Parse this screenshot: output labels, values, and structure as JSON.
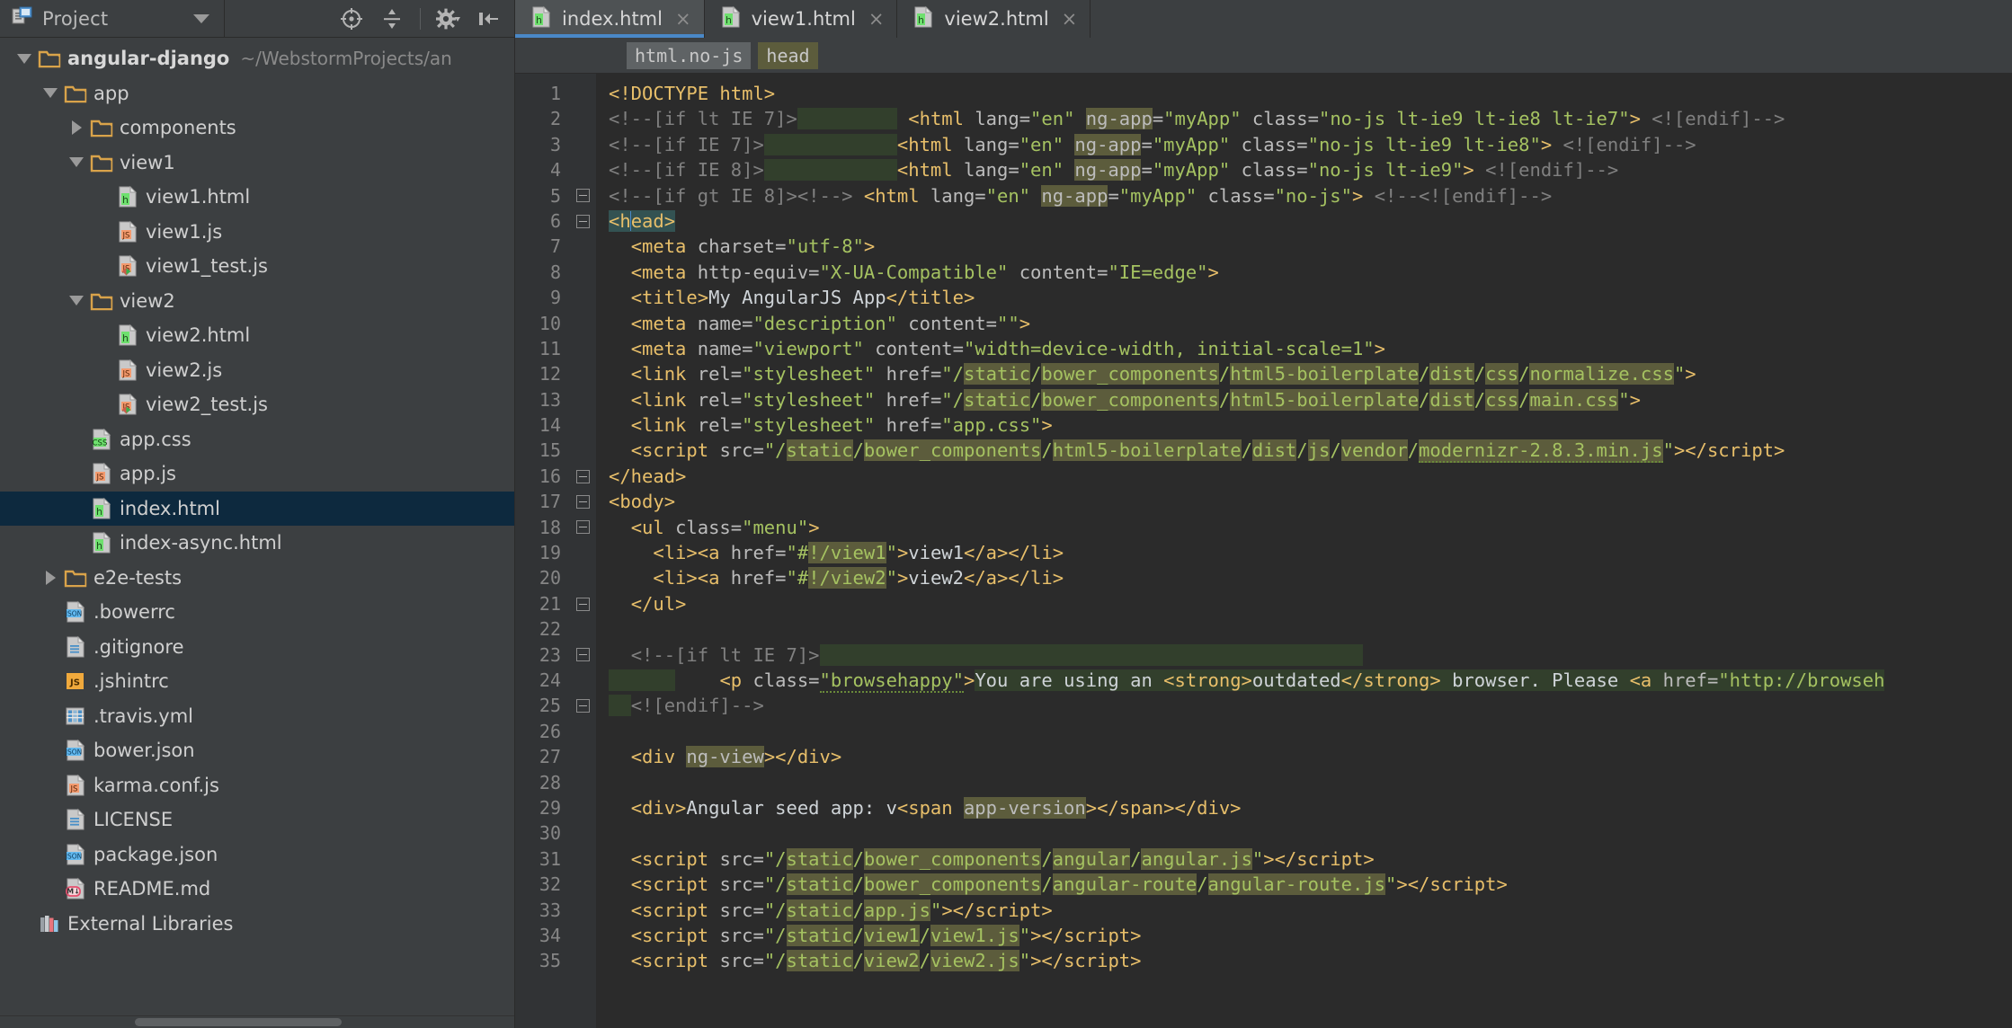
{
  "window": {
    "project_panel_title": "Project",
    "theme_accent": "#4a88c7",
    "editor_bg": "#2b2b2b",
    "panel_bg": "#3c3f41",
    "selection_bg": "#0d293e"
  },
  "toolbar": {
    "icons": [
      {
        "name": "locate-icon",
        "label": "Select Opened File"
      },
      {
        "name": "collapse-all-icon",
        "label": "Collapse All"
      },
      {
        "name": "settings-gear-icon",
        "label": "Settings"
      },
      {
        "name": "hide-panel-icon",
        "label": "Hide"
      }
    ]
  },
  "tabs": [
    {
      "label": "index.html",
      "icon": "html-file-icon",
      "active": true,
      "close": "×"
    },
    {
      "label": "view1.html",
      "icon": "html-file-icon",
      "active": false,
      "close": "×"
    },
    {
      "label": "view2.html",
      "icon": "html-file-icon",
      "active": false,
      "close": "×"
    }
  ],
  "breadcrumb": [
    {
      "label": "html.no-js",
      "style": "gray"
    },
    {
      "label": "head",
      "style": "olive"
    }
  ],
  "tree": [
    {
      "indent": 0,
      "toggle": "open",
      "icon": "folder-icon",
      "label": "angular-django",
      "bold": true,
      "path": "~/WebstormProjects/an",
      "selected": false
    },
    {
      "indent": 1,
      "toggle": "open",
      "icon": "folder-icon",
      "label": "app",
      "bold": false,
      "path": "",
      "selected": false
    },
    {
      "indent": 2,
      "toggle": "closed",
      "icon": "folder-icon",
      "label": "components",
      "bold": false,
      "path": "",
      "selected": false
    },
    {
      "indent": 2,
      "toggle": "open",
      "icon": "folder-icon",
      "label": "view1",
      "bold": false,
      "path": "",
      "selected": false
    },
    {
      "indent": 3,
      "toggle": "none",
      "icon": "html-file-icon",
      "label": "view1.html",
      "bold": false,
      "path": "",
      "selected": false
    },
    {
      "indent": 3,
      "toggle": "none",
      "icon": "js-file-icon",
      "label": "view1.js",
      "bold": false,
      "path": "",
      "selected": false
    },
    {
      "indent": 3,
      "toggle": "none",
      "icon": "js-test-file-icon",
      "label": "view1_test.js",
      "bold": false,
      "path": "",
      "selected": false
    },
    {
      "indent": 2,
      "toggle": "open",
      "icon": "folder-icon",
      "label": "view2",
      "bold": false,
      "path": "",
      "selected": false
    },
    {
      "indent": 3,
      "toggle": "none",
      "icon": "html-file-icon",
      "label": "view2.html",
      "bold": false,
      "path": "",
      "selected": false
    },
    {
      "indent": 3,
      "toggle": "none",
      "icon": "js-file-icon",
      "label": "view2.js",
      "bold": false,
      "path": "",
      "selected": false
    },
    {
      "indent": 3,
      "toggle": "none",
      "icon": "js-test-file-icon",
      "label": "view2_test.js",
      "bold": false,
      "path": "",
      "selected": false
    },
    {
      "indent": 2,
      "toggle": "none",
      "icon": "css-file-icon",
      "label": "app.css",
      "bold": false,
      "path": "",
      "selected": false
    },
    {
      "indent": 2,
      "toggle": "none",
      "icon": "js-file-icon",
      "label": "app.js",
      "bold": false,
      "path": "",
      "selected": false
    },
    {
      "indent": 2,
      "toggle": "none",
      "icon": "html-file-icon",
      "label": "index.html",
      "bold": false,
      "path": "",
      "selected": true
    },
    {
      "indent": 2,
      "toggle": "none",
      "icon": "html-file-icon",
      "label": "index-async.html",
      "bold": false,
      "path": "",
      "selected": false
    },
    {
      "indent": 1,
      "toggle": "closed",
      "icon": "folder-icon",
      "label": "e2e-tests",
      "bold": false,
      "path": "",
      "selected": false
    },
    {
      "indent": 1,
      "toggle": "none",
      "icon": "json-file-icon",
      "label": ".bowerrc",
      "bold": false,
      "path": "",
      "selected": false
    },
    {
      "indent": 1,
      "toggle": "none",
      "icon": "text-file-icon",
      "label": ".gitignore",
      "bold": false,
      "path": "",
      "selected": false
    },
    {
      "indent": 1,
      "toggle": "none",
      "icon": "js-config-icon",
      "label": ".jshintrc",
      "bold": false,
      "path": "",
      "selected": false
    },
    {
      "indent": 1,
      "toggle": "none",
      "icon": "yaml-file-icon",
      "label": ".travis.yml",
      "bold": false,
      "path": "",
      "selected": false
    },
    {
      "indent": 1,
      "toggle": "none",
      "icon": "json-file-icon",
      "label": "bower.json",
      "bold": false,
      "path": "",
      "selected": false
    },
    {
      "indent": 1,
      "toggle": "none",
      "icon": "js-file-icon",
      "label": "karma.conf.js",
      "bold": false,
      "path": "",
      "selected": false
    },
    {
      "indent": 1,
      "toggle": "none",
      "icon": "text-file-icon",
      "label": "LICENSE",
      "bold": false,
      "path": "",
      "selected": false
    },
    {
      "indent": 1,
      "toggle": "none",
      "icon": "json-file-icon",
      "label": "package.json",
      "bold": false,
      "path": "",
      "selected": false
    },
    {
      "indent": 1,
      "toggle": "none",
      "icon": "markdown-file-icon",
      "label": "README.md",
      "bold": false,
      "path": "",
      "selected": false
    },
    {
      "indent": 0,
      "toggle": "none",
      "icon": "libraries-icon",
      "label": "External Libraries",
      "bold": false,
      "path": "",
      "selected": false
    }
  ],
  "editor": {
    "file": "index.html",
    "first_line": 1,
    "last_line": 35,
    "line_numbers": [
      1,
      2,
      3,
      4,
      5,
      6,
      7,
      8,
      9,
      10,
      11,
      12,
      13,
      14,
      15,
      16,
      17,
      18,
      19,
      20,
      21,
      22,
      23,
      24,
      25,
      26,
      27,
      28,
      29,
      30,
      31,
      32,
      33,
      34,
      35
    ],
    "lines": [
      {
        "n": 1,
        "fold": "none",
        "html": "<span class=\"t\">&lt;!DOCTYPE html&gt;</span>"
      },
      {
        "n": 2,
        "fold": "none",
        "html": "<span class=\"cm\">&lt;!--[if lt IE 7]&gt;</span><span class=\"hl-block\">         </span> <span class=\"t\">&lt;html</span> <span class=\"a\">lang=</span><span class=\"v\">\"en\"</span> <span class=\"hl-olive a\">ng-app</span><span class=\"a\">=</span><span class=\"v\">\"myApp\"</span> <span class=\"a\">class=</span><span class=\"v\">\"no-js lt-ie9 lt-ie8 lt-ie7\"</span><span class=\"t\">&gt;</span> <span class=\"cm\">&lt;![endif]--&gt;</span>"
      },
      {
        "n": 3,
        "fold": "none",
        "html": "<span class=\"cm\">&lt;!--[if IE 7]&gt;</span><span class=\"hl-block\">            </span><span class=\"t\">&lt;html</span> <span class=\"a\">lang=</span><span class=\"v\">\"en\"</span> <span class=\"hl-olive a\">ng-app</span><span class=\"a\">=</span><span class=\"v\">\"myApp\"</span> <span class=\"a\">class=</span><span class=\"v\">\"no-js lt-ie9 lt-ie8\"</span><span class=\"t\">&gt;</span> <span class=\"cm\">&lt;![endif]--&gt;</span>"
      },
      {
        "n": 4,
        "fold": "none",
        "html": "<span class=\"cm\">&lt;!--[if IE 8]&gt;</span><span class=\"hl-block\">            </span><span class=\"t\">&lt;html</span> <span class=\"a\">lang=</span><span class=\"v\">\"en\"</span> <span class=\"hl-olive a\">ng-app</span><span class=\"a\">=</span><span class=\"v\">\"myApp\"</span> <span class=\"a\">class=</span><span class=\"v\">\"no-js lt-ie9\"</span><span class=\"t\">&gt;</span> <span class=\"cm\">&lt;![endif]--&gt;</span>"
      },
      {
        "n": 5,
        "fold": "start",
        "html": "<span class=\"cm\">&lt;!--[if gt IE 8]&gt;&lt;!--&gt;</span> <span class=\"t\">&lt;html</span> <span class=\"a\">lang=</span><span class=\"v\">\"en\"</span> <span class=\"hl-olive a\">ng-app</span><span class=\"a\">=</span><span class=\"v\">\"myApp\"</span> <span class=\"a\">class=</span><span class=\"v\">\"no-js\"</span><span class=\"t\">&gt;</span> <span class=\"cm\">&lt;!--&lt;![endif]--&gt;</span>"
      },
      {
        "n": 6,
        "fold": "start",
        "html": "<span class=\"hl-teal t\">&lt;h</span><span class=\"caret\"></span><span class=\"hl-teal t\">ead&gt;</span>"
      },
      {
        "n": 7,
        "fold": "none",
        "html": "  <span class=\"t\">&lt;meta</span> <span class=\"a\">charset=</span><span class=\"v\">\"utf-8\"</span><span class=\"t\">&gt;</span>"
      },
      {
        "n": 8,
        "fold": "none",
        "html": "  <span class=\"t\">&lt;meta</span> <span class=\"a\">http-equiv=</span><span class=\"v\">\"X-UA-Compatible\"</span> <span class=\"a\">content=</span><span class=\"v\">\"IE=edge\"</span><span class=\"t\">&gt;</span>"
      },
      {
        "n": 9,
        "fold": "none",
        "html": "  <span class=\"t\">&lt;title&gt;</span><span class=\"tx\">My AngularJS App</span><span class=\"t\">&lt;/title&gt;</span>"
      },
      {
        "n": 10,
        "fold": "none",
        "html": "  <span class=\"t\">&lt;meta</span> <span class=\"a\">name=</span><span class=\"v\">\"description\"</span> <span class=\"a\">content=</span><span class=\"v\">\"\"</span><span class=\"t\">&gt;</span>"
      },
      {
        "n": 11,
        "fold": "none",
        "html": "  <span class=\"t\">&lt;meta</span> <span class=\"a\">name=</span><span class=\"v\">\"viewport\"</span> <span class=\"a\">content=</span><span class=\"v\">\"width=device-width, initial-scale=1\"</span><span class=\"t\">&gt;</span>"
      },
      {
        "n": 12,
        "fold": "none",
        "html": "  <span class=\"t\">&lt;link</span> <span class=\"a\">rel=</span><span class=\"v\">\"stylesheet\"</span> <span class=\"a\">href=</span><span class=\"v\">\"/</span><span class=\"hl-olive v\">static</span><span class=\"v\">/</span><span class=\"hl-olive v\">bower_components</span><span class=\"v\">/</span><span class=\"hl-olive v\">html5-boilerplate</span><span class=\"v\">/</span><span class=\"hl-olive v\">dist</span><span class=\"v\">/</span><span class=\"hl-olive v\">css</span><span class=\"v\">/</span><span class=\"hl-olive v\">normalize.css</span><span class=\"v\">\"</span><span class=\"t\">&gt;</span>"
      },
      {
        "n": 13,
        "fold": "none",
        "html": "  <span class=\"t\">&lt;link</span> <span class=\"a\">rel=</span><span class=\"v\">\"stylesheet\"</span> <span class=\"a\">href=</span><span class=\"v\">\"/</span><span class=\"hl-olive v\">static</span><span class=\"v\">/</span><span class=\"hl-olive v\">bower_components</span><span class=\"v\">/</span><span class=\"hl-olive v\">html5-boilerplate</span><span class=\"v\">/</span><span class=\"hl-olive v\">dist</span><span class=\"v\">/</span><span class=\"hl-olive v\">css</span><span class=\"v\">/</span><span class=\"hl-olive v\">main.css</span><span class=\"v\">\"</span><span class=\"t\">&gt;</span>"
      },
      {
        "n": 14,
        "fold": "none",
        "html": "  <span class=\"t\">&lt;link</span> <span class=\"a\">rel=</span><span class=\"v\">\"stylesheet\"</span> <span class=\"a\">href=</span><span class=\"v\">\"app.css\"</span><span class=\"t\">&gt;</span>"
      },
      {
        "n": 15,
        "fold": "none",
        "html": "  <span class=\"t\">&lt;script</span> <span class=\"a\">src=</span><span class=\"v\">\"/</span><span class=\"hl-olive v\">static</span><span class=\"v\">/</span><span class=\"hl-olive v\">bower_components</span><span class=\"v\">/</span><span class=\"hl-olive v\">html5-boilerplate</span><span class=\"v\">/</span><span class=\"hl-olive v\">dist</span><span class=\"v\">/</span><span class=\"hl-olive v\">js</span><span class=\"v\">/</span><span class=\"hl-olive v\">vendor</span><span class=\"v\">/</span><span class=\"hl-olive v spell\">modernizr-2.8.3.min.js</span><span class=\"v\">\"</span><span class=\"t\">&gt;&lt;/script&gt;</span>"
      },
      {
        "n": 16,
        "fold": "end",
        "html": "<span class=\"t\">&lt;/head&gt;</span>"
      },
      {
        "n": 17,
        "fold": "start",
        "html": "<span class=\"t\">&lt;body&gt;</span>"
      },
      {
        "n": 18,
        "fold": "start",
        "html": "  <span class=\"t\">&lt;ul</span> <span class=\"a\">class=</span><span class=\"v\">\"menu\"</span><span class=\"t\">&gt;</span>"
      },
      {
        "n": 19,
        "fold": "none",
        "html": "    <span class=\"t\">&lt;li&gt;&lt;a</span> <span class=\"a\">href=</span><span class=\"v\">\"#</span><span class=\"hl-olive v\">!/view1</span><span class=\"v\">\"</span><span class=\"t\">&gt;</span><span class=\"tx\">view1</span><span class=\"t\">&lt;/a&gt;&lt;/li&gt;</span>"
      },
      {
        "n": 20,
        "fold": "none",
        "html": "    <span class=\"t\">&lt;li&gt;&lt;a</span> <span class=\"a\">href=</span><span class=\"v\">\"#</span><span class=\"hl-olive v\">!/view2</span><span class=\"v\">\"</span><span class=\"t\">&gt;</span><span class=\"tx\">view2</span><span class=\"t\">&lt;/a&gt;&lt;/li&gt;</span>"
      },
      {
        "n": 21,
        "fold": "end",
        "html": "  <span class=\"t\">&lt;/ul&gt;</span>"
      },
      {
        "n": 22,
        "fold": "none",
        "html": ""
      },
      {
        "n": 23,
        "fold": "start",
        "html": "  <span class=\"cm\">&lt;!--[if lt IE 7]&gt;</span><span class=\"hl-block\">                                                 </span>"
      },
      {
        "n": 24,
        "fold": "none",
        "html": "<span class=\"hl-block\">      </span>    <span class=\"t\">&lt;p</span> <span class=\"a\">class=</span><span class=\"v spell\">\"browsehappy\"</span><span class=\"t\">&gt;</span><span class=\"hl-block tx\">You are using an </span><span class=\"hl-block t\">&lt;strong&gt;</span><span class=\"hl-block tx\">outdated</span><span class=\"hl-block t\">&lt;/strong&gt;</span><span class=\"hl-block tx\"> browser. Please </span><span class=\"hl-block t\">&lt;a</span><span class=\"hl-block\"> </span><span class=\"hl-block a\">href=</span><span class=\"hl-block v\">\"http://browseh</span>"
      },
      {
        "n": 25,
        "fold": "end",
        "html": "<span class=\"hl-block\">  </span><span class=\"cm\">&lt;![endif]--&gt;</span>"
      },
      {
        "n": 26,
        "fold": "none",
        "html": ""
      },
      {
        "n": 27,
        "fold": "none",
        "html": "  <span class=\"t\">&lt;div</span> <span class=\"hl-olive a\">ng-view</span><span class=\"t\">&gt;&lt;/div&gt;</span>"
      },
      {
        "n": 28,
        "fold": "none",
        "html": ""
      },
      {
        "n": 29,
        "fold": "none",
        "html": "  <span class=\"t\">&lt;div&gt;</span><span class=\"tx\">Angular seed app: v</span><span class=\"t\">&lt;span</span> <span class=\"hl-olive a\">app-version</span><span class=\"t\">&gt;&lt;/span&gt;&lt;/div&gt;</span>"
      },
      {
        "n": 30,
        "fold": "none",
        "html": ""
      },
      {
        "n": 31,
        "fold": "none",
        "html": "  <span class=\"t\">&lt;script</span> <span class=\"a\">src=</span><span class=\"v\">\"/</span><span class=\"hl-olive v\">static</span><span class=\"v\">/</span><span class=\"hl-olive v\">bower_components</span><span class=\"v\">/</span><span class=\"hl-olive v\">angular</span><span class=\"v\">/</span><span class=\"hl-olive v\">angular.js</span><span class=\"v\">\"</span><span class=\"t\">&gt;&lt;/script&gt;</span>"
      },
      {
        "n": 32,
        "fold": "none",
        "html": "  <span class=\"t\">&lt;script</span> <span class=\"a\">src=</span><span class=\"v\">\"/</span><span class=\"hl-olive v\">static</span><span class=\"v\">/</span><span class=\"hl-olive v\">bower_components</span><span class=\"v\">/</span><span class=\"hl-olive v\">angular-route</span><span class=\"v\">/</span><span class=\"hl-olive v\">angular-route.js</span><span class=\"v\">\"</span><span class=\"t\">&gt;&lt;/script&gt;</span>"
      },
      {
        "n": 33,
        "fold": "none",
        "html": "  <span class=\"t\">&lt;script</span> <span class=\"a\">src=</span><span class=\"v\">\"/</span><span class=\"hl-olive v\">static</span><span class=\"v\">/</span><span class=\"hl-olive v\">app.js</span><span class=\"v\">\"</span><span class=\"t\">&gt;&lt;/script&gt;</span>"
      },
      {
        "n": 34,
        "fold": "none",
        "html": "  <span class=\"t\">&lt;script</span> <span class=\"a\">src=</span><span class=\"v\">\"/</span><span class=\"hl-olive v\">static</span><span class=\"v\">/</span><span class=\"hl-olive v\">view1</span><span class=\"v\">/</span><span class=\"hl-olive v\">view1.js</span><span class=\"v\">\"</span><span class=\"t\">&gt;&lt;/script&gt;</span>"
      },
      {
        "n": 35,
        "fold": "none",
        "html": "  <span class=\"t\">&lt;script</span> <span class=\"a\">src=</span><span class=\"v\">\"/</span><span class=\"hl-olive v\">static</span><span class=\"v\">/</span><span class=\"hl-olive v\">view2</span><span class=\"v\">/</span><span class=\"hl-olive v\">view2.js</span><span class=\"v\">\"</span><span class=\"t\">&gt;&lt;/script&gt;</span>"
      }
    ]
  }
}
